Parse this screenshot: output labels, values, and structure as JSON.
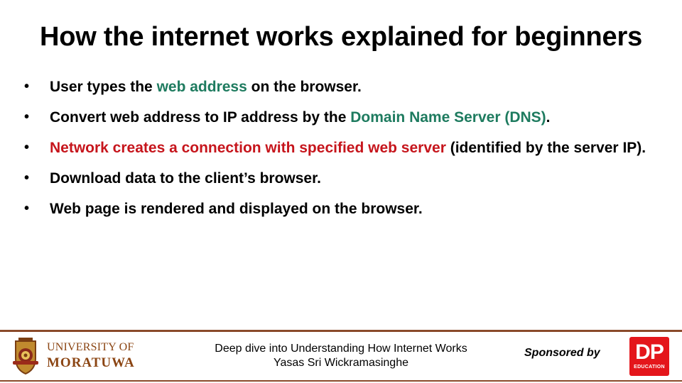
{
  "slide": {
    "title": "How the internet works explained for beginners"
  },
  "bullets": [
    {
      "marker": "•",
      "segments": [
        {
          "text": "User types the ",
          "color": "default"
        },
        {
          "text": "web address",
          "color": "green"
        },
        {
          "text": " on the browser.",
          "color": "default"
        }
      ]
    },
    {
      "marker": "•",
      "segments": [
        {
          "text": "Convert web address to IP address by the ",
          "color": "default"
        },
        {
          "text": "Domain Name Server (DNS)",
          "color": "green"
        },
        {
          "text": ".",
          "color": "default"
        }
      ]
    },
    {
      "marker": "•",
      "segments": [
        {
          "text": "Network creates a connection with specified web server",
          "color": "red"
        },
        {
          "text": " (identified by the server IP).",
          "color": "default"
        }
      ]
    },
    {
      "marker": "•",
      "segments": [
        {
          "text": "Download data to the client’s browser.",
          "color": "default"
        }
      ]
    },
    {
      "marker": "•",
      "segments": [
        {
          "text": "Web page is rendered and displayed on the browser.",
          "color": "default"
        }
      ]
    }
  ],
  "footer": {
    "university_line1": "UNIVERSITY OF",
    "university_line2": "MORATUWA",
    "course_title": "Deep dive into Understanding How Internet Works",
    "author": "Yasas Sri Wickramasinghe",
    "sponsored_by": "Sponsored by",
    "dp_main": "DP",
    "dp_sub": "EDUCATION"
  },
  "colors": {
    "green": "#1e7b5f",
    "red": "#c6151c",
    "footer_rule": "#8a4a2a",
    "university_text": "#8b4513",
    "dp_brand": "#e4161b"
  },
  "icons": {
    "university_logo": "university-crest-icon",
    "sponsor_logo": "dp-education-logo"
  }
}
